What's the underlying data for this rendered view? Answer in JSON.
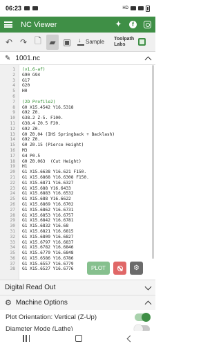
{
  "status_bar": {
    "time": "06:23",
    "right_text": "HD"
  },
  "app_bar": {
    "title": "NC Viewer",
    "brand_color": "#3f8f46"
  },
  "toolbar": {
    "sample_label": "Sample",
    "brand_line1": "Toolpath",
    "brand_line2": "Labs"
  },
  "file": {
    "name": "1001.nc"
  },
  "code_lines": [
    {
      "n": "1",
      "text": "(v1.6-af)",
      "comment": true
    },
    {
      "n": "2",
      "text": "G90 G94",
      "comment": false
    },
    {
      "n": "3",
      "text": "G17",
      "comment": false
    },
    {
      "n": "4",
      "text": "G20",
      "comment": false
    },
    {
      "n": "5",
      "text": "H0",
      "comment": false
    },
    {
      "n": "6",
      "text": "",
      "comment": false
    },
    {
      "n": "7",
      "text": "(2D Profile2)",
      "comment": true
    },
    {
      "n": "8",
      "text": "G0 X15.4542 Y16.5318",
      "comment": false
    },
    {
      "n": "9",
      "text": "G92 Z0.",
      "comment": false
    },
    {
      "n": "10",
      "text": "G38.2 Z-5. F100.",
      "comment": false
    },
    {
      "n": "11",
      "text": "G38.4 Z0.5 F20.",
      "comment": false
    },
    {
      "n": "12",
      "text": "G92 Z0.",
      "comment": false
    },
    {
      "n": "13",
      "text": "G0 Z0.04 (IHS Springback + Backlash)",
      "comment": false
    },
    {
      "n": "14",
      "text": "G92 Z0.",
      "comment": false
    },
    {
      "n": "15",
      "text": "G0 Z0.15 (Pierce Height)",
      "comment": false
    },
    {
      "n": "16",
      "text": "M3",
      "comment": false
    },
    {
      "n": "17",
      "text": "G4 P0.5",
      "comment": false
    },
    {
      "n": "18",
      "text": "G0 Z0.063  (Cut Height)",
      "comment": false
    },
    {
      "n": "19",
      "text": "H1",
      "comment": false
    },
    {
      "n": "20",
      "text": "G1 X15.6638 Y16.621 F150.",
      "comment": false
    },
    {
      "n": "21",
      "text": "G1 X15.6868 Y16.6308 F150.",
      "comment": false
    },
    {
      "n": "22",
      "text": "G1 X15.6871 Y16.6327",
      "comment": false
    },
    {
      "n": "23",
      "text": "G1 X15.688 Y16.6433",
      "comment": false
    },
    {
      "n": "24",
      "text": "G1 X15.6883 Y16.6532",
      "comment": false
    },
    {
      "n": "25",
      "text": "G1 X15.688 Y16.6622",
      "comment": false
    },
    {
      "n": "26",
      "text": "G1 X15.6869 Y16.6702",
      "comment": false
    },
    {
      "n": "27",
      "text": "G1 X15.6862 Y16.6731",
      "comment": false
    },
    {
      "n": "28",
      "text": "G1 X15.6853 Y16.6757",
      "comment": false
    },
    {
      "n": "29",
      "text": "G1 X15.6842 Y16.6781",
      "comment": false
    },
    {
      "n": "30",
      "text": "G1 X15.6832 Y16.68",
      "comment": false
    },
    {
      "n": "31",
      "text": "G1 X15.6821 Y16.6815",
      "comment": false
    },
    {
      "n": "32",
      "text": "G1 X15.6809 Y16.6827",
      "comment": false
    },
    {
      "n": "33",
      "text": "G1 X15.6797 Y16.6837",
      "comment": false
    },
    {
      "n": "34",
      "text": "G1 X15.6782 Y16.6846",
      "comment": false
    },
    {
      "n": "35",
      "text": "G1 X15.6779 Y16.6848",
      "comment": false
    },
    {
      "n": "36",
      "text": "G1 X15.6586 Y16.6786",
      "comment": false
    },
    {
      "n": "37",
      "text": "G1 X15.6557 Y16.6779",
      "comment": false
    },
    {
      "n": "38",
      "text": "G1 X15.6527 Y16.6776",
      "comment": false
    }
  ],
  "actions": {
    "plot_label": "PLOT"
  },
  "panels": {
    "dro_title": "Digital Read Out",
    "machine_title": "Machine Options"
  },
  "options": {
    "plot_orientation_label": "Plot Orientation:",
    "plot_orientation_value": "Vertical (Z-Up)",
    "diameter_mode_label": "Diameter Mode (Lathe)"
  }
}
